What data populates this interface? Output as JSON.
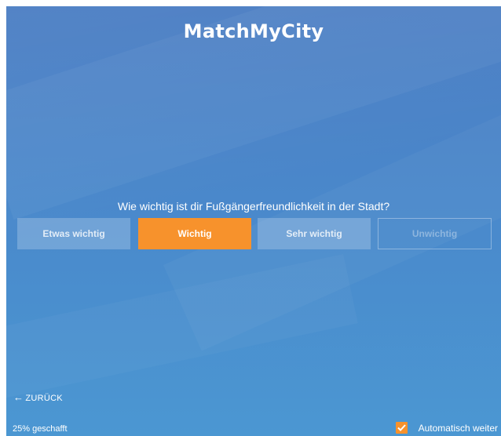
{
  "app": {
    "logo": "MatchMyCity"
  },
  "quiz": {
    "question": "Wie wichtig ist dir Fußgängerfreundlichkeit in der Stadt?",
    "options": [
      {
        "label": "Etwas wichtig",
        "state": "default"
      },
      {
        "label": "Wichtig",
        "state": "selected"
      },
      {
        "label": "Sehr wichtig",
        "state": "default"
      },
      {
        "label": "Unwichtig",
        "state": "outline"
      }
    ]
  },
  "footer": {
    "back_arrow": "←",
    "back_label": "ZURÜCK",
    "progress_text": "25% geschafft",
    "progress_fraction": 0.25,
    "auto_next_label": "Automatisch weiter",
    "auto_next_checked": true
  },
  "colors": {
    "accent": "#f7922c",
    "background_top": "#4a7dc3",
    "background_bottom": "#4b97d2",
    "text": "#ffffff"
  },
  "icons": {
    "back": "arrow-left-icon",
    "checkbox": "checkmark-icon"
  }
}
